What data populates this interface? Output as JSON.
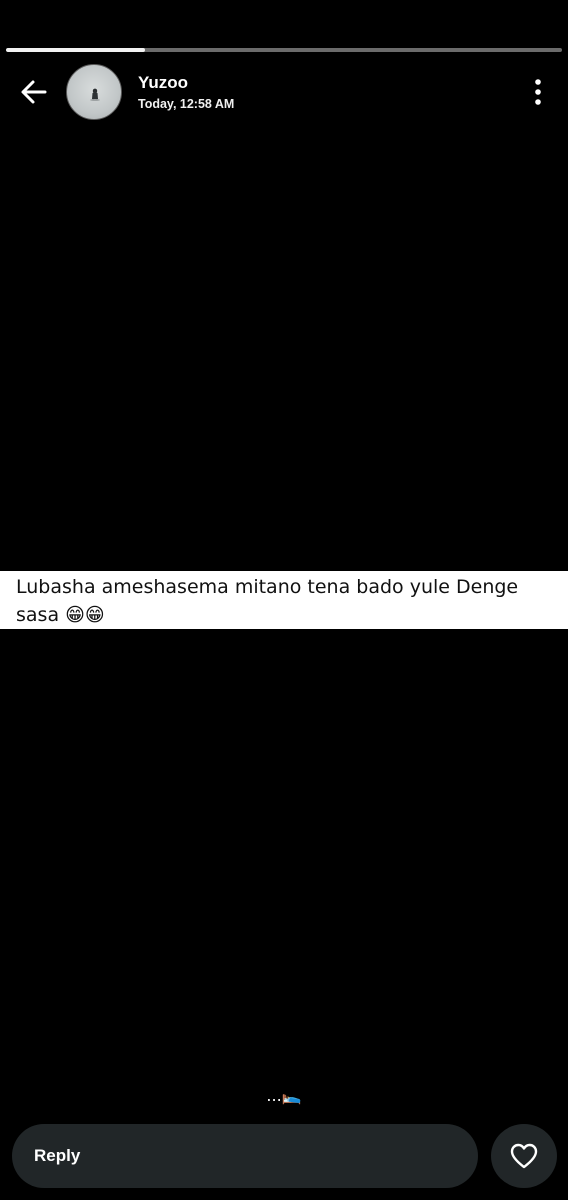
{
  "story": {
    "progress": 0.25,
    "user": {
      "name": "Yuzoo",
      "time": "Today, 12:58 AM"
    },
    "caption": "Lubasha ameshasema mitano tena bado yule Denge sasa 😁😁",
    "bottom_text": "...🛌"
  },
  "icons": {
    "back": "arrow-left-icon",
    "menu": "more-vertical-icon",
    "like": "heart-icon"
  },
  "reply": {
    "label": "Reply"
  },
  "colors": {
    "background": "#000000",
    "caption_background": "#ffffff",
    "reply_bar": "#212628",
    "progress_fill": "#f2f2f2",
    "progress_track": "#6b6b6b"
  }
}
